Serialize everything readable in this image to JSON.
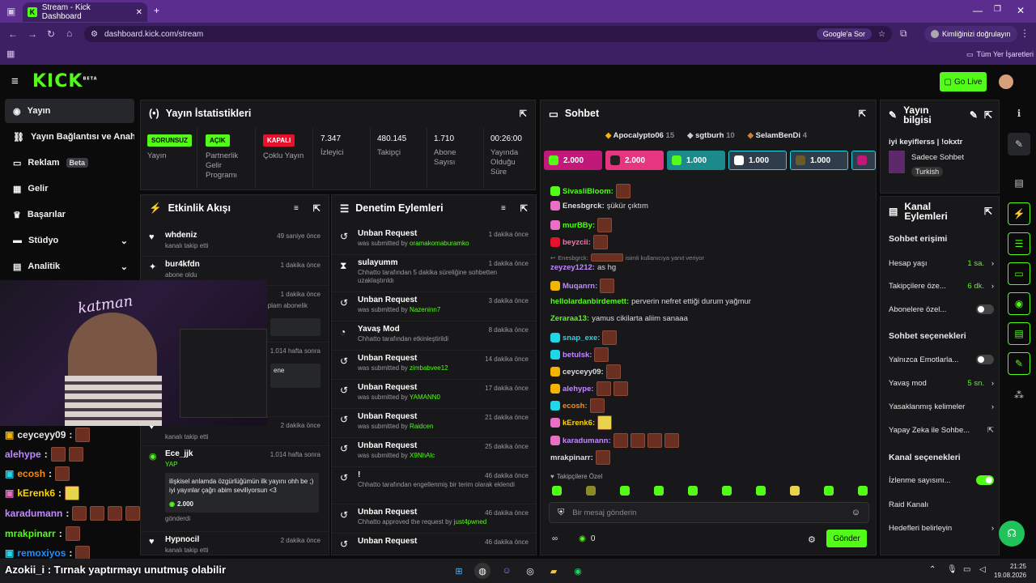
{
  "browser": {
    "tab_title": "Stream - Kick Dashboard",
    "url": "dashboard.kick.com/stream",
    "google_btn": "Google'a Sor",
    "identity_btn": "Kimliğinizi doğrulayın",
    "bookmarks": "Tüm Yer İşaretleri"
  },
  "header": {
    "logo": "KICK",
    "logo_badge": "BETA",
    "golive": "Go Live"
  },
  "nav": {
    "items": [
      {
        "label": "Yayın"
      },
      {
        "label": "Yayın Bağlantısı ve Anahtar"
      },
      {
        "label": "Reklam",
        "badge": "Beta"
      },
      {
        "label": "Gelir"
      },
      {
        "label": "Başarılar"
      },
      {
        "label": "Stüdyo"
      },
      {
        "label": "Analitik"
      }
    ]
  },
  "stats": {
    "title": "Yayın İstatistikleri",
    "cols": [
      {
        "tag": "SORUNSUZ",
        "tag_color": "#53fc18",
        "label": "Yayın"
      },
      {
        "tag": "AÇIK",
        "tag_color": "#53fc18",
        "label": "Partnerlik Gelir Programı"
      },
      {
        "tag": "KAPALI",
        "tag_color": "#e8112d",
        "label": "Çoklu Yayın"
      },
      {
        "value": "7.347",
        "label": "İzleyici"
      },
      {
        "value": "480.145",
        "label": "Takipçi"
      },
      {
        "value": "1.710",
        "label": "Abone Sayısı"
      },
      {
        "value": "00:26:00",
        "label": "Yayında Olduğu Süre"
      }
    ]
  },
  "activity": {
    "title": "Etkinlik Akışı",
    "items": [
      {
        "name": "whdeniz",
        "sub": "kanalı takip etti",
        "time": "49 saniye önce"
      },
      {
        "name": "bur4kfdn",
        "sub": "abone oldu",
        "time": "1 dakika önce"
      },
      {
        "name": "",
        "sub": "...plam abonelik",
        "time": "1 dakika önce"
      },
      {
        "name": "",
        "sub": "",
        "time": "1.014 hafta sonra"
      },
      {
        "name": "",
        "sub": "kanalı takip etti",
        "time": "2 dakika önce"
      },
      {
        "name": "Ece_jjk",
        "sub": "YAP",
        "time": "1.014 hafta sonra",
        "msg": "ilişkisel anlamda özgürlüğümün ilk yayını ohh be ;) iyi yayınlar çağrı abim seviliyorsun <3",
        "amount": "2.000",
        "footer": "gönderdi"
      },
      {
        "name": "Hypnocil",
        "sub": "kanalı takip etti",
        "time": "2 dakika önce"
      }
    ],
    "partial_text": "ene"
  },
  "mod": {
    "title": "Denetim Eylemleri",
    "items": [
      {
        "title": "Unban Request",
        "sub": "was submitted by",
        "who": "oramakomaburamko",
        "time": "1 dakika önce"
      },
      {
        "title": "sulayumm",
        "sub": "Chhatto tarafından 5 dakika süreliğine sohbetten uzaklaştırıldı",
        "time": "1 dakika önce"
      },
      {
        "title": "Unban Request",
        "sub": "was submitted by",
        "who": "Nazeninn7",
        "time": "3 dakika önce"
      },
      {
        "title": "Yavaş Mod",
        "sub": "Chhatto tarafından etkinleştirildi",
        "time": "8 dakika önce"
      },
      {
        "title": "Unban Request",
        "sub": "was submitted by",
        "who": "zimbabvee12",
        "time": "14 dakika önce"
      },
      {
        "title": "Unban Request",
        "sub": "was submitted by",
        "who": "YAMANN0",
        "time": "17 dakika önce"
      },
      {
        "title": "Unban Request",
        "sub": "was submitted by",
        "who": "Raidcen",
        "time": "21 dakika önce"
      },
      {
        "title": "Unban Request",
        "sub": "was submitted by",
        "who": "X9NhAlc",
        "time": "25 dakika önce"
      },
      {
        "title": "!",
        "sub": "Chhatto tarafından engellenmiş bir terim olarak eklendi",
        "time": "46 dakika önce"
      },
      {
        "title": "Unban Request",
        "sub": "Chhatto approved the request by",
        "who": "just4pwned",
        "time": "46 dakika önce"
      },
      {
        "title": "Unban Request",
        "sub": "",
        "time": "46 dakika önce"
      }
    ]
  },
  "chat": {
    "title": "Sohbet",
    "top": [
      {
        "name": "Apocalypto06",
        "n": "15"
      },
      {
        "name": "sgtburh",
        "n": "10"
      },
      {
        "name": "SelamBenDi",
        "n": "4"
      }
    ],
    "tiles": [
      {
        "amount": "2.000",
        "color": "#c2187a"
      },
      {
        "amount": "2.000",
        "color": "#e8357f"
      },
      {
        "amount": "1.000",
        "color": "#1a8a8a"
      },
      {
        "amount": "1.000",
        "color": "#2f3d4a"
      },
      {
        "amount": "1.000",
        "color": "#2f3d4a"
      }
    ],
    "lines": [
      {
        "user": "SivasliBloom:",
        "color": "#53fc18",
        "text": ""
      },
      {
        "user": "Enesbgrck:",
        "color": "#ffffff",
        "text": "şükür çıktım"
      },
      {
        "user": "murBBy:",
        "color": "#53fc18",
        "text": ""
      },
      {
        "user": "beyzcii:",
        "color": "#ff6fa8",
        "text": ""
      },
      {
        "reply": "Enesbgrck:",
        "reply_text": "isimli kullanıcıya yanıt veriyor"
      },
      {
        "user": "zeyzey1212:",
        "color": "#c08aff",
        "text": "as hg"
      },
      {
        "user": "Muqanrn:",
        "color": "#c08aff",
        "text": ""
      },
      {
        "user": "helloIardanbirdemett:",
        "color": "#53fc18",
        "text": "perverin nefret ettiği durum yağmur"
      },
      {
        "user": "Zeraraa13:",
        "color": "#53fc18",
        "text": "yamus cikilarta aliim sanaaa"
      },
      {
        "user": "snap_exe:",
        "color": "#1ed7e8",
        "text": ""
      },
      {
        "user": "betulsk:",
        "color": "#c08aff",
        "text": ""
      },
      {
        "user": "ceyceyy09:",
        "color": "#ffffff",
        "text": ""
      },
      {
        "user": "alehype:",
        "color": "#c08aff",
        "text": ""
      },
      {
        "user": "ecosh:",
        "color": "#ff8a00",
        "text": ""
      },
      {
        "user": "kErenk6:",
        "color": "#ffd400",
        "text": ""
      },
      {
        "user": "karadumann:",
        "color": "#c08aff",
        "text": ""
      },
      {
        "user": "mrakpinarr:",
        "color": "#ffffff",
        "text": ""
      }
    ],
    "mode": "Takipçilere Özel",
    "placeholder": "Bir mesaj gönderin",
    "points": "0",
    "send": "Gönder"
  },
  "info": {
    "title": "Yayın bilgisi",
    "stream_title": "iyi keyiflerss | !okxtr",
    "category": "Sadece Sohbet",
    "lang": "Turkish"
  },
  "actions": {
    "title": "Kanal Eylemleri",
    "access_title": "Sohbet erişimi",
    "access": [
      {
        "label": "Hesap yaşı",
        "value": "1 sa."
      },
      {
        "label": "Takipçilere öze...",
        "value": "6 dk."
      },
      {
        "label": "Abonelere özel...",
        "toggle": "off"
      }
    ],
    "opts_title": "Sohbet seçenekleri",
    "opts": [
      {
        "label": "Yalnızca Emotlarla...",
        "toggle": "off"
      },
      {
        "label": "Yavaş mod",
        "value": "5 sn."
      },
      {
        "label": "Yasaklanmış kelimeler"
      },
      {
        "label": "Yapay Zeka ile Sohbe..."
      }
    ],
    "ch_title": "Kanal seçenekleri",
    "ch": [
      {
        "label": "İzlenme sayısını...",
        "toggle": "on"
      },
      {
        "label": "Raid Kanalı"
      },
      {
        "label": "Hedefleri belirleyin"
      }
    ]
  },
  "overlay": {
    "lines": [
      {
        "user": "ceyceyy09",
        "color": "#ffffff"
      },
      {
        "user": "alehype",
        "color": "#c08aff"
      },
      {
        "user": "ecosh",
        "color": "#ff8a00"
      },
      {
        "user": "kErenk6",
        "color": "#ffd400"
      },
      {
        "user": "karadumann",
        "color": "#c08aff"
      },
      {
        "user": "mrakpinarr",
        "color": "#53fc18"
      },
      {
        "user": "remoxiyos",
        "color": "#1e90ff"
      }
    ],
    "ticker": "Azokii_i : Tırnak yaptırmayı unutmuş olabilir",
    "cam_text": "katman"
  },
  "taskbar": {
    "time": "21:25",
    "date": "19.08.2026"
  }
}
